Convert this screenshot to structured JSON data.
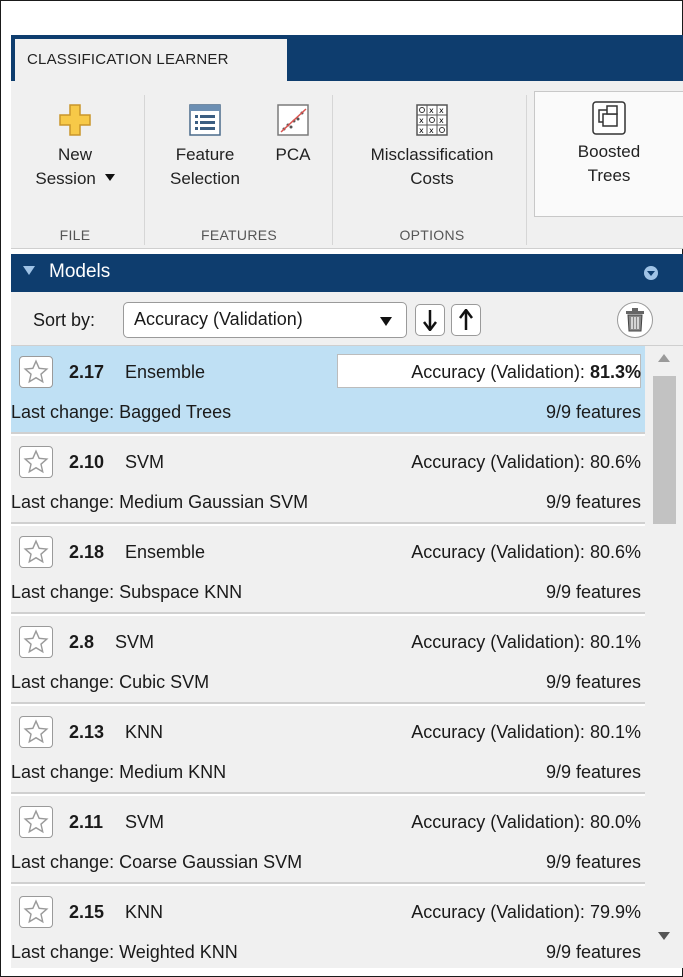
{
  "tab": {
    "label": "CLASSIFICATION LEARNER"
  },
  "toolstrip": {
    "new_session_line1": "New",
    "new_session_line2": "Session",
    "file_section": "FILE",
    "feature_selection_line1": "Feature",
    "feature_selection_line2": "Selection",
    "pca_label": "PCA",
    "features_section": "FEATURES",
    "misclassification_line1": "Misclassification",
    "misclassification_line2": "Costs",
    "options_section": "OPTIONS",
    "boosted_line1": "Boosted",
    "boosted_line2": "Trees"
  },
  "models_panel": {
    "title": "Models",
    "sort_label": "Sort by:",
    "sort_value": "Accuracy (Validation)",
    "models": [
      {
        "id": "2.17",
        "type": "Ensemble",
        "accuracy_label": "Accuracy (Validation):",
        "accuracy": "81.3%",
        "last_change": "Last change: Bagged Trees",
        "features": "9/9 features",
        "selected": true
      },
      {
        "id": "2.10",
        "type": "SVM",
        "accuracy_label": "Accuracy (Validation):",
        "accuracy": "80.6%",
        "last_change": "Last change: Medium Gaussian SVM",
        "features": "9/9 features",
        "selected": false
      },
      {
        "id": "2.18",
        "type": "Ensemble",
        "accuracy_label": "Accuracy (Validation):",
        "accuracy": "80.6%",
        "last_change": "Last change: Subspace KNN",
        "features": "9/9 features",
        "selected": false
      },
      {
        "id": "2.8",
        "type": "SVM",
        "accuracy_label": "Accuracy (Validation):",
        "accuracy": "80.1%",
        "last_change": "Last change: Cubic SVM",
        "features": "9/9 features",
        "selected": false
      },
      {
        "id": "2.13",
        "type": "KNN",
        "accuracy_label": "Accuracy (Validation):",
        "accuracy": "80.1%",
        "last_change": "Last change: Medium KNN",
        "features": "9/9 features",
        "selected": false
      },
      {
        "id": "2.11",
        "type": "SVM",
        "accuracy_label": "Accuracy (Validation):",
        "accuracy": "80.0%",
        "last_change": "Last change: Coarse Gaussian SVM",
        "features": "9/9 features",
        "selected": false
      },
      {
        "id": "2.15",
        "type": "KNN",
        "accuracy_label": "Accuracy (Validation):",
        "accuracy": "79.9%",
        "last_change": "Last change: Weighted KNN",
        "features": "9/9 features",
        "selected": false
      }
    ]
  },
  "colors": {
    "header_blue": "#0e3d6e",
    "selected_row": "#bfe0f4",
    "toolstrip_bg": "#f0f0f0"
  },
  "icons": [
    "new-session-plus-icon",
    "feature-selection-icon",
    "pca-icon",
    "misclassification-grid-icon",
    "boosted-trees-icon",
    "star-icon",
    "sort-down-icon",
    "sort-up-icon",
    "trash-icon"
  ]
}
